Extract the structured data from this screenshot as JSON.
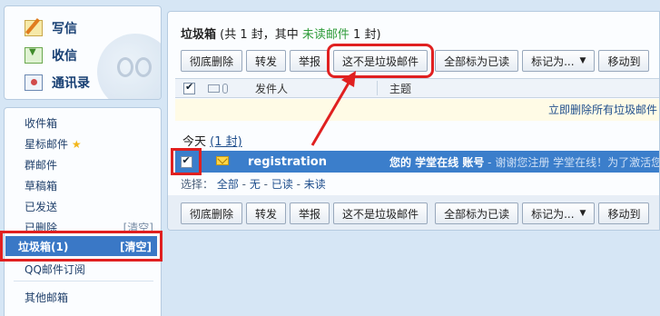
{
  "sidebar": {
    "compose_items": [
      {
        "label": "写信",
        "icon": "pencil-icon"
      },
      {
        "label": "收信",
        "icon": "inbox-download-icon"
      },
      {
        "label": "通讯录",
        "icon": "contacts-card-icon"
      }
    ],
    "folders": [
      {
        "label": "收件箱"
      },
      {
        "label": "星标邮件"
      },
      {
        "label": "群邮件"
      },
      {
        "label": "草稿箱"
      },
      {
        "label": "已发送"
      },
      {
        "label": "已删除",
        "action": "[清空]"
      },
      {
        "label": "垃圾箱(1)",
        "action": "[清空]",
        "active": true
      },
      {
        "label": "QQ邮件订阅"
      },
      {
        "label": "其他邮箱"
      }
    ]
  },
  "main": {
    "title": {
      "folder": "垃圾箱",
      "prefix": " (共 1 封，其中 ",
      "unread": "未读邮件",
      "suffix": " 1 封)"
    },
    "toolbar": {
      "delete": "彻底删除",
      "forward": "转发",
      "report": "举报",
      "not_spam": "这不是垃圾邮件",
      "mark_all_read": "全部标为已读",
      "mark_as": "标记为...",
      "move_to": "移动到"
    },
    "list_header": {
      "sender": "发件人",
      "subject": "主题"
    },
    "notice": "立即删除所有垃圾邮件",
    "group": {
      "label": "今天",
      "count": "(1 封)"
    },
    "mail": {
      "sender": "registration",
      "subject": "您的 学堂在线 账号",
      "preview": " - 谢谢您注册 学堂在线！为了激活您"
    },
    "select_bar": {
      "prefix": "选择：",
      "all": "全部",
      "none": "无",
      "read": "已读",
      "unread": "未读",
      "sep": " - "
    }
  },
  "colors": {
    "highlight_red": "#e02020",
    "selected_row": "#3b7ecb",
    "unread_green": "#2f9c3a"
  }
}
